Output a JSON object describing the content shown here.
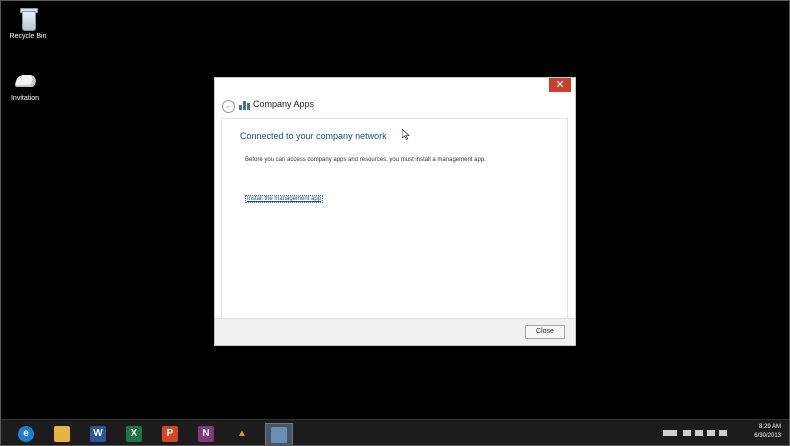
{
  "desktop": {
    "icons": [
      {
        "label": "Recycle Bin",
        "icon": "recycle-bin-icon"
      },
      {
        "label": "Invitation",
        "icon": "invitation-icon"
      }
    ]
  },
  "dialog": {
    "close_glyph": "✕",
    "back_glyph": "←",
    "title": "Company Apps",
    "heading": "Connected to your company network",
    "body": "Before you can access company apps and resources, you must install a management app.",
    "install_link": "Install the management app",
    "close_button": "Close",
    "colors": {
      "close": "#c7402e",
      "heading": "#1a4f8a"
    }
  },
  "taskbar": {
    "apps": [
      {
        "name": "Internet Explorer",
        "glyph": "e",
        "color": "#1e7fd0"
      },
      {
        "name": "File Explorer",
        "glyph": "",
        "color": "#e4b545"
      },
      {
        "name": "Word",
        "glyph": "W",
        "color": "#2b579a"
      },
      {
        "name": "Excel",
        "glyph": "X",
        "color": "#217346"
      },
      {
        "name": "PowerPoint",
        "glyph": "P",
        "color": "#d24726"
      },
      {
        "name": "OneNote",
        "glyph": "N",
        "color": "#80397b"
      },
      {
        "name": "VLC",
        "glyph": "▲",
        "color": "#2a2a2a"
      },
      {
        "name": "Company Apps",
        "glyph": "",
        "color": "#6a8fb5"
      }
    ],
    "clock": {
      "time": "8:29 AM",
      "date": "6/30/2013"
    }
  }
}
